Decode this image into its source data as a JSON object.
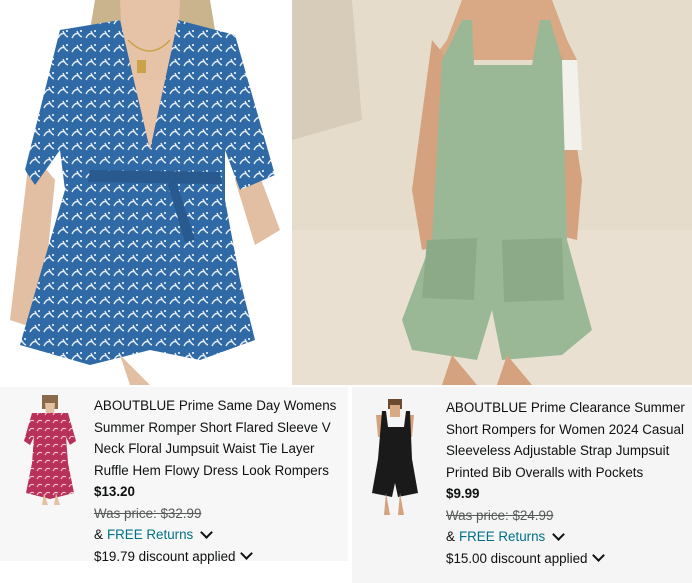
{
  "products": [
    {
      "title": "ABOUTBLUE Prime Same Day Womens Summer Romper Short Flared Sleeve V Neck Floral Jumpsuit Waist Tie Layer Ruffle Hem Flowy Dress Look Rompers",
      "price": "$13.20",
      "was_price": "Was price: $32.99",
      "returns_prefix": "&",
      "returns_label": "FREE Returns",
      "discount": "$19.79 discount applied",
      "thumb_color": "#b8315b"
    },
    {
      "title": "ABOUTBLUE Prime Clearance Summer Short Rompers for Women 2024 Casual Sleeveless Adjustable Strap Jumpsuit Printed Bib Overalls with Pockets",
      "price": "$9.99",
      "was_price": "Was price: $24.99",
      "returns_prefix": "&",
      "returns_label": "FREE Returns",
      "discount": "$15.00 discount applied",
      "thumb_color": "#1a1a1a"
    }
  ],
  "hero": {
    "left_color": "#2f6aa6",
    "right_color": "#9bb896"
  }
}
